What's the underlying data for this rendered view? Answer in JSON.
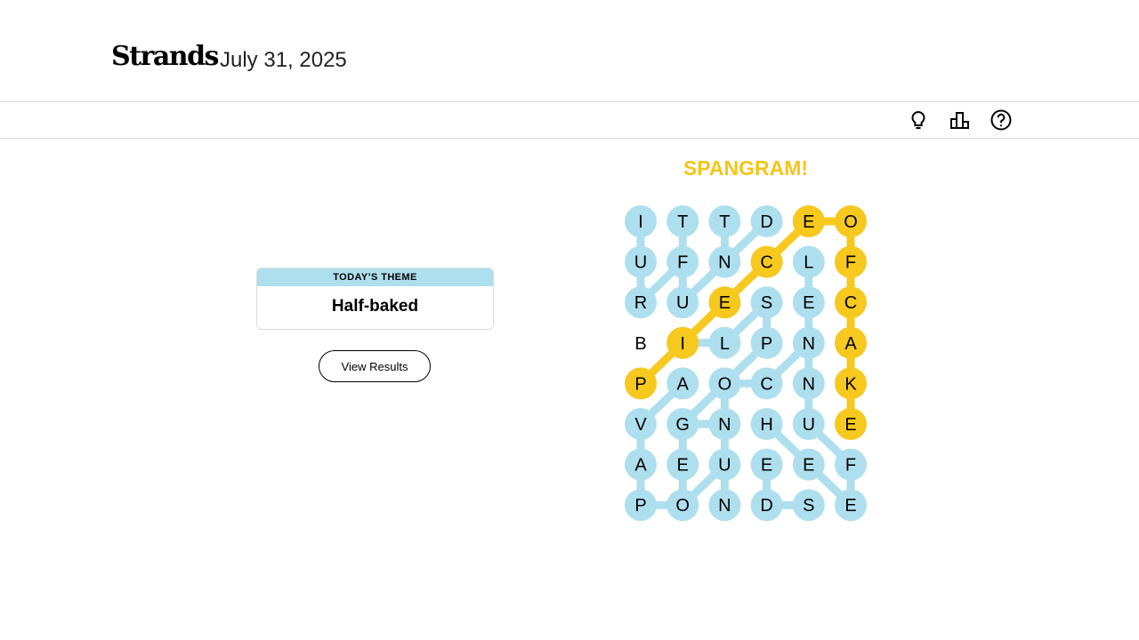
{
  "header": {
    "app_title": "Strands",
    "date": "July 31, 2025"
  },
  "toolbar": {
    "icons": [
      "hint-lightbulb-icon",
      "stats-icon",
      "help-icon"
    ]
  },
  "theme": {
    "heading": "TODAY’S THEME",
    "title": "Half-baked"
  },
  "view_results_label": "View Results",
  "status_text": "SPANGRAM!",
  "colors": {
    "found": "#aedfee",
    "spangram": "#f7c81e",
    "divider": "#d9d9d9"
  },
  "board": {
    "rows": [
      [
        "I",
        "T",
        "T",
        "D",
        "E",
        "O"
      ],
      [
        "U",
        "F",
        "N",
        "C",
        "L",
        "F"
      ],
      [
        "R",
        "U",
        "E",
        "S",
        "E",
        "C"
      ],
      [
        "B",
        "I",
        "L",
        "P",
        "N",
        "A"
      ],
      [
        "P",
        "A",
        "O",
        "C",
        "N",
        "K"
      ],
      [
        "V",
        "G",
        "N",
        "H",
        "U",
        "E"
      ],
      [
        "A",
        "E",
        "U",
        "E",
        "E",
        "F"
      ],
      [
        "P",
        "O",
        "N",
        "D",
        "S",
        "E"
      ]
    ],
    "words": [
      {
        "type": "spangram",
        "path": [
          [
            4,
            0
          ],
          [
            3,
            1
          ],
          [
            2,
            2
          ],
          [
            1,
            3
          ],
          [
            0,
            4
          ],
          [
            0,
            5
          ],
          [
            1,
            5
          ],
          [
            2,
            5
          ],
          [
            3,
            5
          ],
          [
            4,
            5
          ],
          [
            5,
            5
          ]
        ]
      },
      {
        "type": "theme",
        "path": [
          [
            0,
            0
          ],
          [
            1,
            0
          ],
          [
            2,
            0
          ],
          [
            1,
            1
          ],
          [
            0,
            1
          ]
        ]
      },
      {
        "type": "theme",
        "path": [
          [
            0,
            2
          ],
          [
            1,
            2
          ],
          [
            2,
            1
          ],
          [
            1,
            1
          ]
        ]
      },
      {
        "type": "theme",
        "path": [
          [
            1,
            2
          ],
          [
            0,
            3
          ]
        ]
      },
      {
        "type": "theme",
        "path": [
          [
            2,
            3
          ],
          [
            3,
            3
          ],
          [
            4,
            2
          ],
          [
            5,
            1
          ]
        ]
      },
      {
        "type": "theme",
        "path": [
          [
            3,
            1
          ],
          [
            3,
            2
          ]
        ]
      },
      {
        "type": "theme",
        "path": [
          [
            1,
            4
          ],
          [
            2,
            4
          ],
          [
            3,
            4
          ],
          [
            4,
            4
          ],
          [
            5,
            4
          ],
          [
            6,
            5
          ]
        ]
      },
      {
        "type": "theme",
        "path": [
          [
            4,
            1
          ],
          [
            5,
            0
          ],
          [
            6,
            0
          ],
          [
            7,
            0
          ],
          [
            7,
            1
          ],
          [
            6,
            1
          ],
          [
            5,
            1
          ],
          [
            5,
            2
          ],
          [
            4,
            2
          ],
          [
            4,
            3
          ]
        ]
      },
      {
        "type": "theme",
        "path": [
          [
            4,
            2
          ],
          [
            5,
            2
          ],
          [
            6,
            2
          ],
          [
            7,
            2
          ],
          [
            6,
            2
          ],
          [
            7,
            1
          ]
        ]
      },
      {
        "type": "theme",
        "path": [
          [
            5,
            3
          ],
          [
            6,
            4
          ],
          [
            7,
            5
          ],
          [
            6,
            5
          ]
        ]
      },
      {
        "type": "theme",
        "path": [
          [
            6,
            3
          ],
          [
            7,
            3
          ],
          [
            7,
            4
          ]
        ]
      },
      {
        "type": "theme",
        "path": [
          [
            4,
            3
          ],
          [
            3,
            4
          ]
        ]
      },
      {
        "type": "theme",
        "path": [
          [
            2,
            3
          ],
          [
            3,
            2
          ]
        ]
      },
      {
        "type": "theme",
        "path": [
          [
            4,
            2
          ],
          [
            3,
            3
          ]
        ]
      }
    ]
  }
}
